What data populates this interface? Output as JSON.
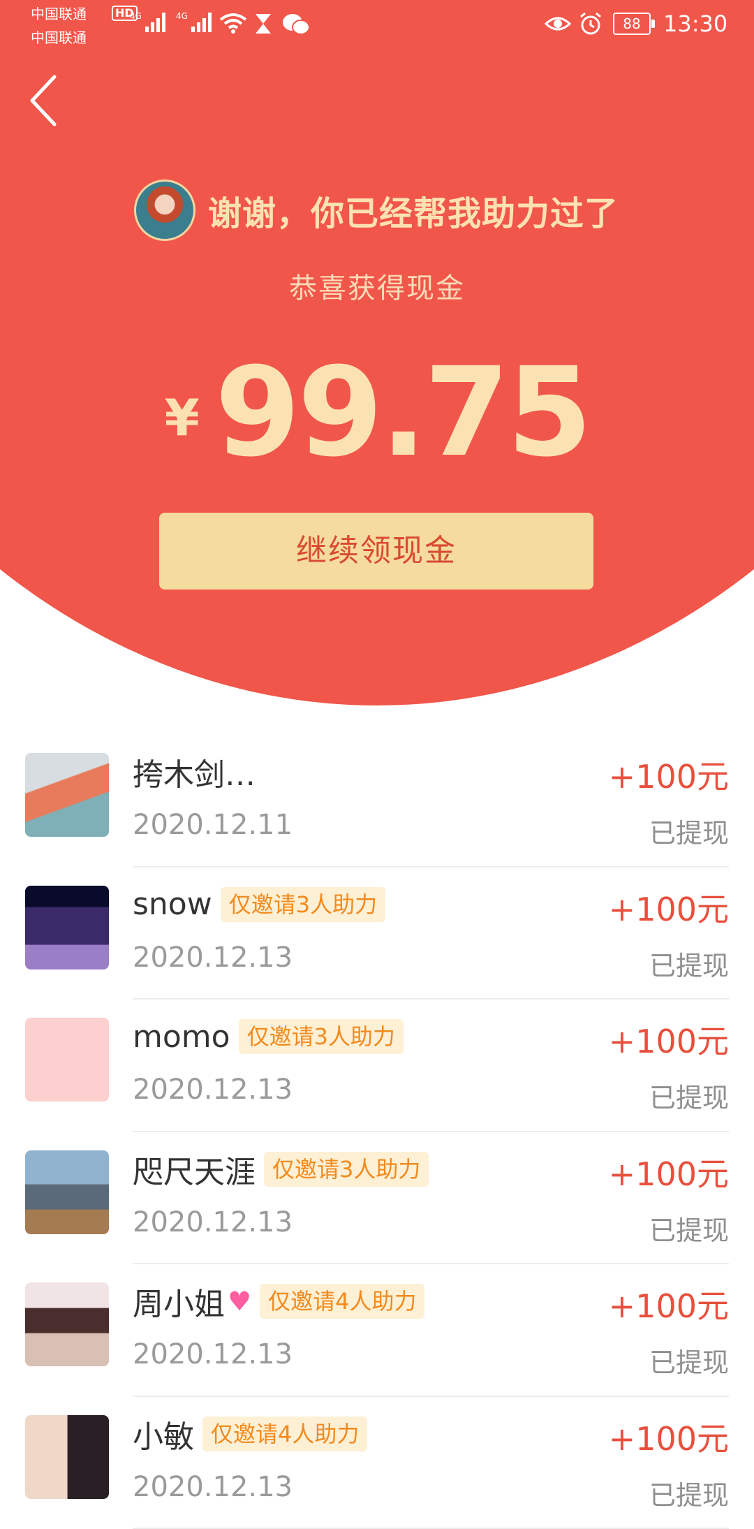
{
  "status_bar": {
    "carrier_1": "中国联通",
    "carrier_2": "中国联通",
    "hd_badge": "HD",
    "network_1": "4G",
    "network_2": "4G",
    "battery": "88",
    "time": "13:30"
  },
  "hero": {
    "greeting": "谢谢，你已经帮我助力过了",
    "subtitle": "恭喜获得现金",
    "currency": "¥",
    "amount": "99.75",
    "cta_label": "继续领现金"
  },
  "colors": {
    "hero_bg": "#F1564A",
    "hero_text": "#FCE2B2",
    "cta_bg": "#F5DC9E",
    "cta_text": "#D94A33",
    "amount_text": "#E8503D",
    "tag_bg": "#FDF0D4",
    "tag_text": "#F28A1E"
  },
  "records": [
    {
      "name": "挎木剑…",
      "tag": "",
      "heart": false,
      "date": "2020.12.11",
      "amount": "+100元",
      "status": "已提现"
    },
    {
      "name": "snow",
      "tag": "仅邀请3人助力",
      "heart": false,
      "date": "2020.12.13",
      "amount": "+100元",
      "status": "已提现"
    },
    {
      "name": "momo",
      "tag": "仅邀请3人助力",
      "heart": false,
      "date": "2020.12.13",
      "amount": "+100元",
      "status": "已提现"
    },
    {
      "name": "咫尺天涯",
      "tag": "仅邀请3人助力",
      "heart": false,
      "date": "2020.12.13",
      "amount": "+100元",
      "status": "已提现"
    },
    {
      "name": "周小姐",
      "tag": "仅邀请4人助力",
      "heart": true,
      "date": "2020.12.13",
      "amount": "+100元",
      "status": "已提现"
    },
    {
      "name": "小敏",
      "tag": "仅邀请4人助力",
      "heart": false,
      "date": "2020.12.13",
      "amount": "+100元",
      "status": "已提现"
    }
  ],
  "icons": [
    "back-arrow-icon",
    "wifi-icon",
    "hourglass-icon",
    "wechat-icon",
    "eye-icon",
    "alarm-icon",
    "heart-emoji-icon"
  ]
}
